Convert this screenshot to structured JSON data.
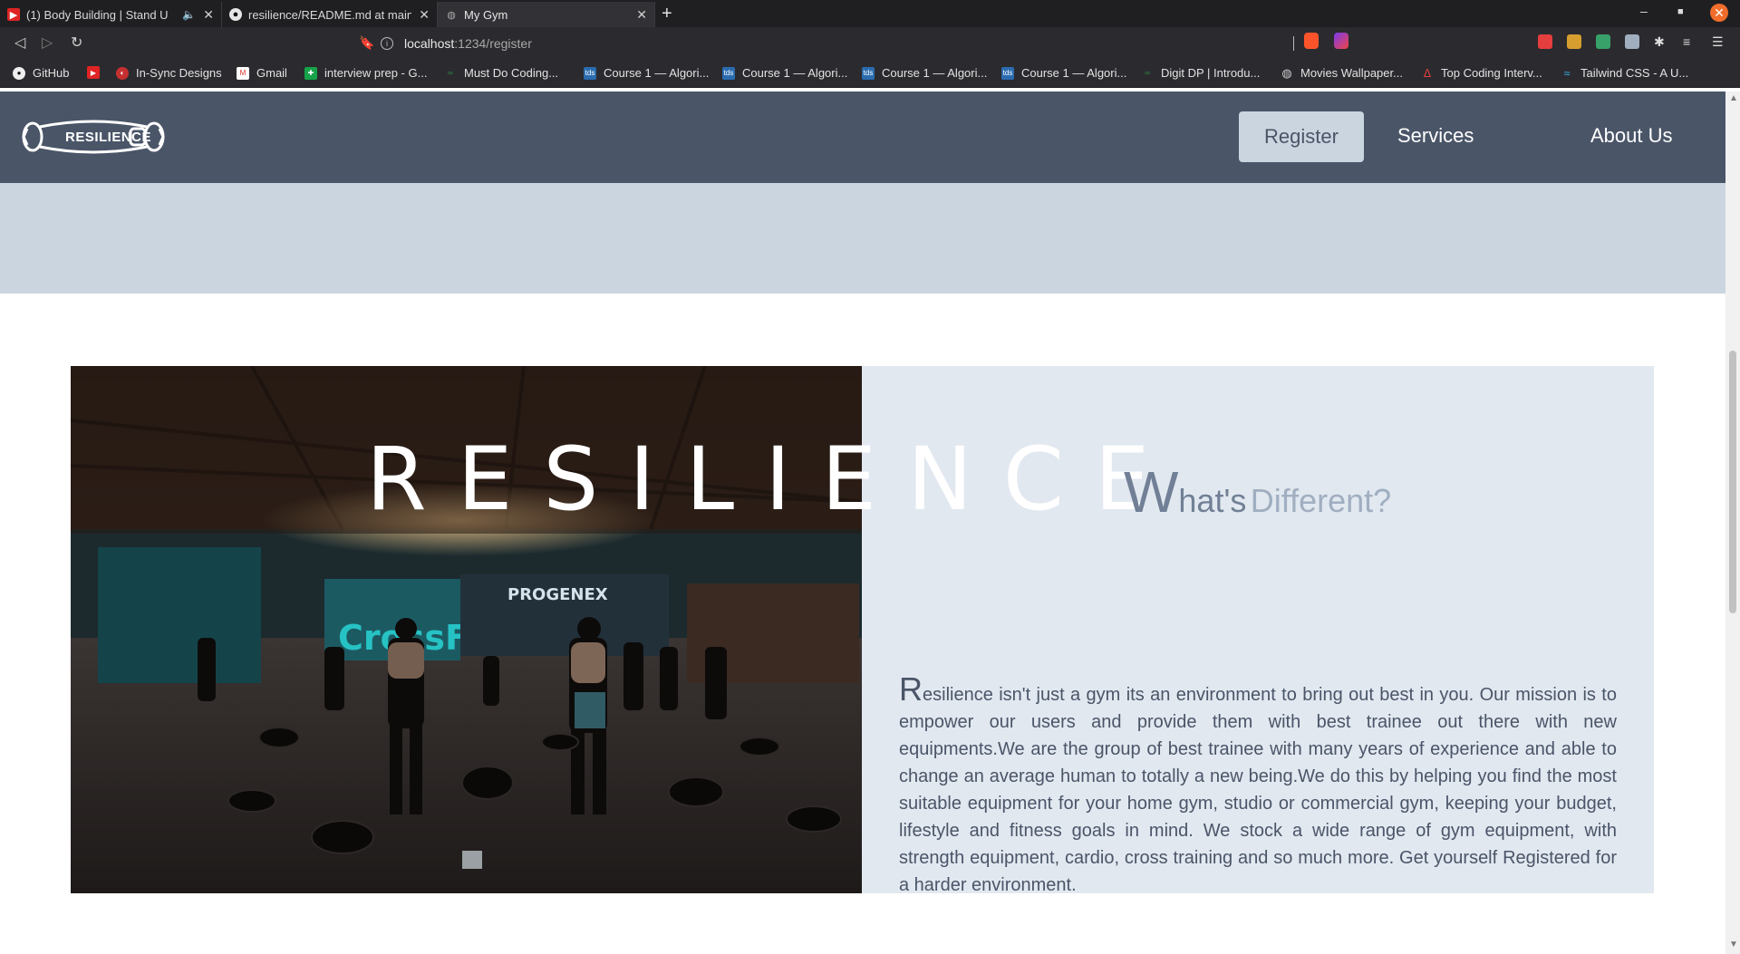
{
  "browser": {
    "tabs": [
      {
        "title": "(1) Body Building | Stand U",
        "favicon": "youtube-icon",
        "audio": true
      },
      {
        "title": "resilience/README.md at main",
        "favicon": "github-icon"
      },
      {
        "title": "My Gym",
        "favicon": "globe-icon",
        "active": true
      }
    ],
    "address": {
      "host": "localhost",
      "path": ":1234/register"
    },
    "bookmarks": [
      {
        "label": "GitHub",
        "icon": "github-icon"
      },
      {
        "label": "",
        "icon": "youtube-icon"
      },
      {
        "label": "In-Sync Designs",
        "icon": "insync-icon"
      },
      {
        "label": "Gmail",
        "icon": "gmail-icon"
      },
      {
        "label": "interview prep - G...",
        "icon": "sheets-icon"
      },
      {
        "label": "Must Do Coding...",
        "icon": "gfg-icon"
      },
      {
        "label": "Course 1 — Algori...",
        "icon": "tds-icon"
      },
      {
        "label": "Course 1 — Algori...",
        "icon": "tds-icon"
      },
      {
        "label": "Course 1 — Algori...",
        "icon": "tds-icon"
      },
      {
        "label": "Course 1 — Algori...",
        "icon": "tds-icon"
      },
      {
        "label": "Digit DP | Introdu...",
        "icon": "gfg-icon"
      },
      {
        "label": "Movies Wallpaper...",
        "icon": "globe-icon"
      },
      {
        "label": "Top Coding Interv...",
        "icon": "coding-icon"
      },
      {
        "label": "Tailwind CSS - A U...",
        "icon": "tailwind-icon"
      }
    ]
  },
  "site": {
    "logo_text": "RESILIENCE",
    "nav": {
      "register": "Register",
      "services": "Services",
      "about": "About Us"
    },
    "hero_title": "RESILIENCE",
    "diff": {
      "w": "W",
      "hat": "hat's",
      "different": "Different?"
    },
    "para": {
      "dropcap": "R",
      "text": "esilience isn't just a gym its an environment to bring out best in you. Our mission is to empower our users and provide them with best trainee out there with new equipments.We are the group of best trainee with many years of experience and able to change an average human to totally a new being.We do this by helping you find the most suitable equipment for your home gym, studio or commercial gym, keeping your budget, lifestyle and fitness goals in mind. We stock a wide range of gym equipment, with strength equipment, cardio, cross training and so much more. Get yourself Registered for a harder environment."
    },
    "photo_signs": {
      "brand": "PROGENEX",
      "box": "CrossFit"
    }
  },
  "colors": {
    "navbar": "#4a5568",
    "band": "#cbd5e0",
    "card": "#e2e8f0",
    "text": "#4a5568",
    "muted": "#a0aec0"
  }
}
